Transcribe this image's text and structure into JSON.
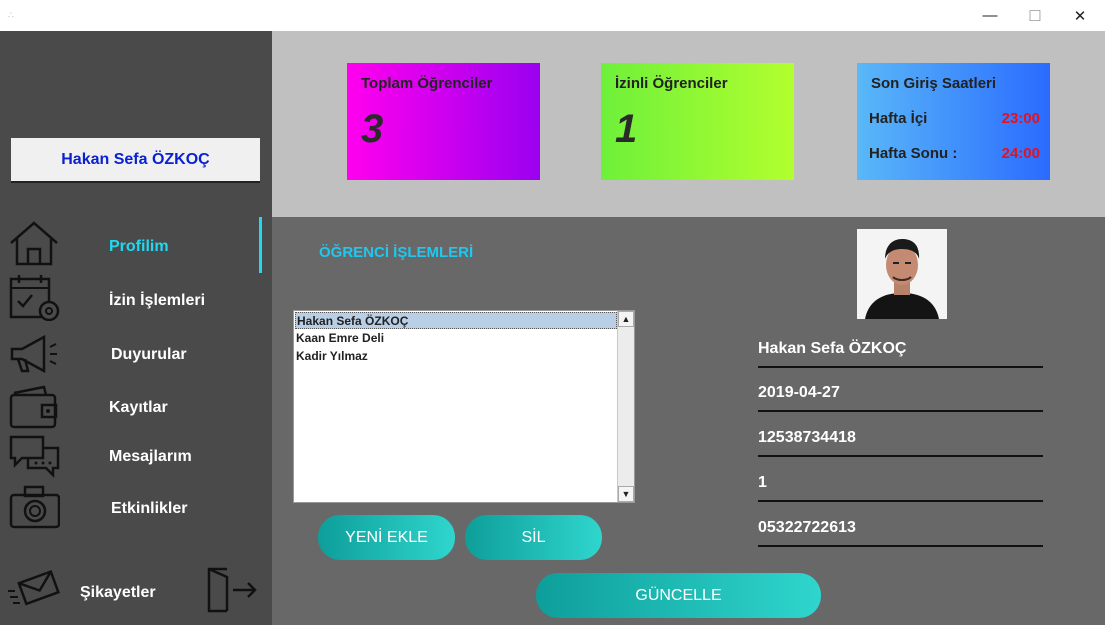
{
  "window": {
    "minimize": "—",
    "maximize": "☐",
    "close": "✕"
  },
  "sidebar": {
    "user_name": "Hakan Sefa ÖZKOÇ",
    "items": [
      {
        "label": "Profilim",
        "icon": "home-icon",
        "active": true
      },
      {
        "label": "İzin İşlemleri",
        "icon": "calendar-icon",
        "active": false
      },
      {
        "label": "Duyurular",
        "icon": "megaphone-icon",
        "active": false
      },
      {
        "label": "Kayıtlar",
        "icon": "wallet-icon",
        "active": false
      },
      {
        "label": "Mesajlarım",
        "icon": "chat-icon",
        "active": false
      },
      {
        "label": "Etkinlikler",
        "icon": "camera-icon",
        "active": false
      }
    ],
    "complaints": {
      "label": "Şikayetler",
      "icon": "envelope-icon"
    },
    "logout_icon": "logout-door-icon"
  },
  "stats": {
    "total": {
      "title": "Toplam Öğrenciler",
      "value": "3"
    },
    "permitted": {
      "title": "İzinli Öğrenciler",
      "value": "1"
    },
    "login_hours": {
      "title": "Son Giriş Saatleri",
      "weekday_label": "Hafta İçi",
      "weekday_value": "23:00",
      "weekend_label": "Hafta Sonu :",
      "weekend_value": "24:00"
    }
  },
  "main": {
    "section_title": "ÖĞRENCİ İŞLEMLERİ",
    "students": [
      "Hakan Sefa ÖZKOÇ",
      "Kaan Emre Deli",
      "Kadir Yılmaz"
    ],
    "buttons": {
      "add": "YENİ EKLE",
      "delete": "SİL",
      "update": "GÜNCELLE"
    },
    "details": {
      "name": "Hakan Sefa ÖZKOÇ",
      "date": "2019-04-27",
      "id_number": "12538734418",
      "class": "1",
      "phone": "05322722613"
    }
  },
  "colors": {
    "sidebar_bg": "#4a4a4a",
    "accent": "#22d8f0",
    "card1_gradient": [
      "#ff00ee",
      "#9b00f0"
    ],
    "card2_gradient": [
      "#6ef03a",
      "#b2ff2e"
    ],
    "card3_gradient": [
      "#5ab8f8",
      "#2a6bff"
    ],
    "time_value": "#e8101a"
  }
}
